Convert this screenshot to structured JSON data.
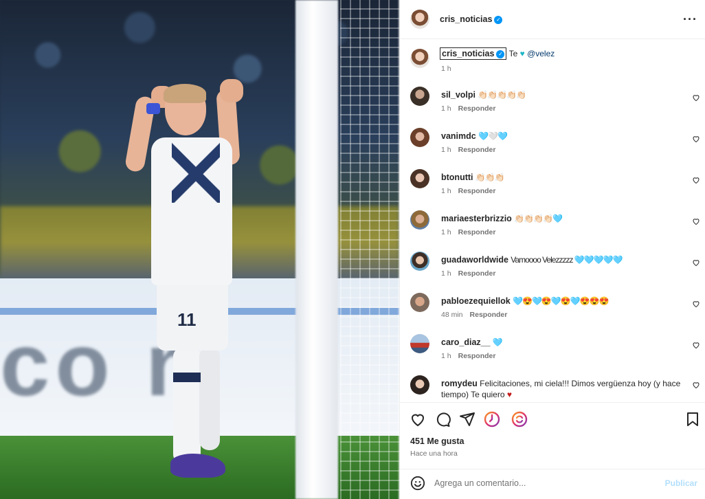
{
  "post": {
    "author": "cris_noticias",
    "caption_user": "cris_noticias",
    "caption_text": "Te",
    "caption_mention": "@velez",
    "caption_time": "1 h",
    "likes": "451 Me gusta",
    "posted": "Hace una hora"
  },
  "comments": [
    {
      "user": "sil_volpi",
      "text": "👏🏻👏🏻👏🏻👏🏻👏🏻",
      "time": "1 h",
      "reply": "Responder"
    },
    {
      "user": "vanimdc",
      "text": "🩵🤍🩵",
      "time": "1 h",
      "reply": "Responder"
    },
    {
      "user": "btonutti",
      "text": "👏🏻👏🏻👏🏻",
      "time": "1 h",
      "reply": "Responder"
    },
    {
      "user": "mariaesterbrizzio",
      "text": "👏🏻👏🏻👏🏻👏🏻🩵",
      "time": "1 h",
      "reply": "Responder"
    },
    {
      "user": "guadaworldwide",
      "text": "Vamoooo Velezzzzz 🩵🩵🩵🩵🩵",
      "time": "1 h",
      "reply": "Responder"
    },
    {
      "user": "pabloezequiellok",
      "text": "🩵😍🩵😍🩵😍🩵😍😍😍",
      "time": "48 min",
      "reply": "Responder"
    },
    {
      "user": "caro_diaz__",
      "text": "🩵",
      "time": "1 h",
      "reply": "Responder"
    },
    {
      "user": "romydeu",
      "text": "Felicitaciones, mi ciela!!! Dimos vergüenza hoy (y hace tiempo) Te quiero",
      "time": "",
      "reply": ""
    }
  ],
  "add_comment": {
    "placeholder": "Agrega un comentario...",
    "publish": "Publicar"
  },
  "colors": {
    "verified": "#0095f6",
    "mention": "#00376b",
    "publish_disabled": "#b2dffc",
    "teal_heart": "#1eb6c4"
  }
}
